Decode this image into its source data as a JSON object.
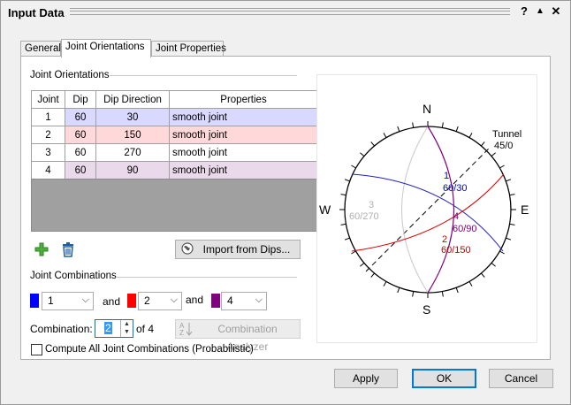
{
  "window": {
    "title": "Input Data",
    "help": "?",
    "collapse": "▲",
    "close": "✕"
  },
  "tabs": [
    {
      "label": "General",
      "active": false
    },
    {
      "label": "Joint Orientations",
      "active": true
    },
    {
      "label": "Joint Properties",
      "active": false
    }
  ],
  "joint_orientations": {
    "group_label": "Joint Orientations",
    "columns": [
      "Joint",
      "Dip",
      "Dip Direction",
      "Properties"
    ],
    "rows": [
      {
        "joint": "1",
        "dip": "60",
        "dip_direction": "30",
        "properties": "smooth joint",
        "color": "#d9d9ff"
      },
      {
        "joint": "2",
        "dip": "60",
        "dip_direction": "150",
        "properties": "smooth joint",
        "color": "#ffd9d9"
      },
      {
        "joint": "3",
        "dip": "60",
        "dip_direction": "270",
        "properties": "smooth joint",
        "color": "#ffffff"
      },
      {
        "joint": "4",
        "dip": "60",
        "dip_direction": "90",
        "properties": "smooth joint",
        "color": "#ead9ea"
      }
    ],
    "add_icon": "plus-icon",
    "delete_icon": "trash-icon",
    "import_label": "Import from Dips..."
  },
  "joint_combinations": {
    "group_label": "Joint Combinations",
    "and1": "and",
    "and2": "and",
    "combos": [
      {
        "value": "1",
        "color": "#0000ff"
      },
      {
        "value": "2",
        "color": "#ff0000"
      },
      {
        "value": "4",
        "color": "#800080"
      }
    ],
    "combination_label": "Combination:",
    "combination_value": "2",
    "of_label": "of 4",
    "analyzer_label": "Combination Analyzer",
    "compute_all_label": "Compute All Joint Combinations (Probabilistic)"
  },
  "stereonet": {
    "north": "N",
    "south": "S",
    "east": "E",
    "west": "W",
    "tunnel_label": "Tunnel",
    "tunnel_orientation": "45/0",
    "joints": [
      {
        "id": "1",
        "label": "60/30",
        "color": "#0000cc"
      },
      {
        "id": "2",
        "label": "60/150",
        "color": "#cc0000"
      },
      {
        "id": "3",
        "label": "60/270",
        "color": "#b0b0b0"
      },
      {
        "id": "4",
        "label": "60/90",
        "color": "#800080"
      }
    ]
  },
  "footer": {
    "apply": "Apply",
    "ok": "OK",
    "cancel": "Cancel"
  }
}
